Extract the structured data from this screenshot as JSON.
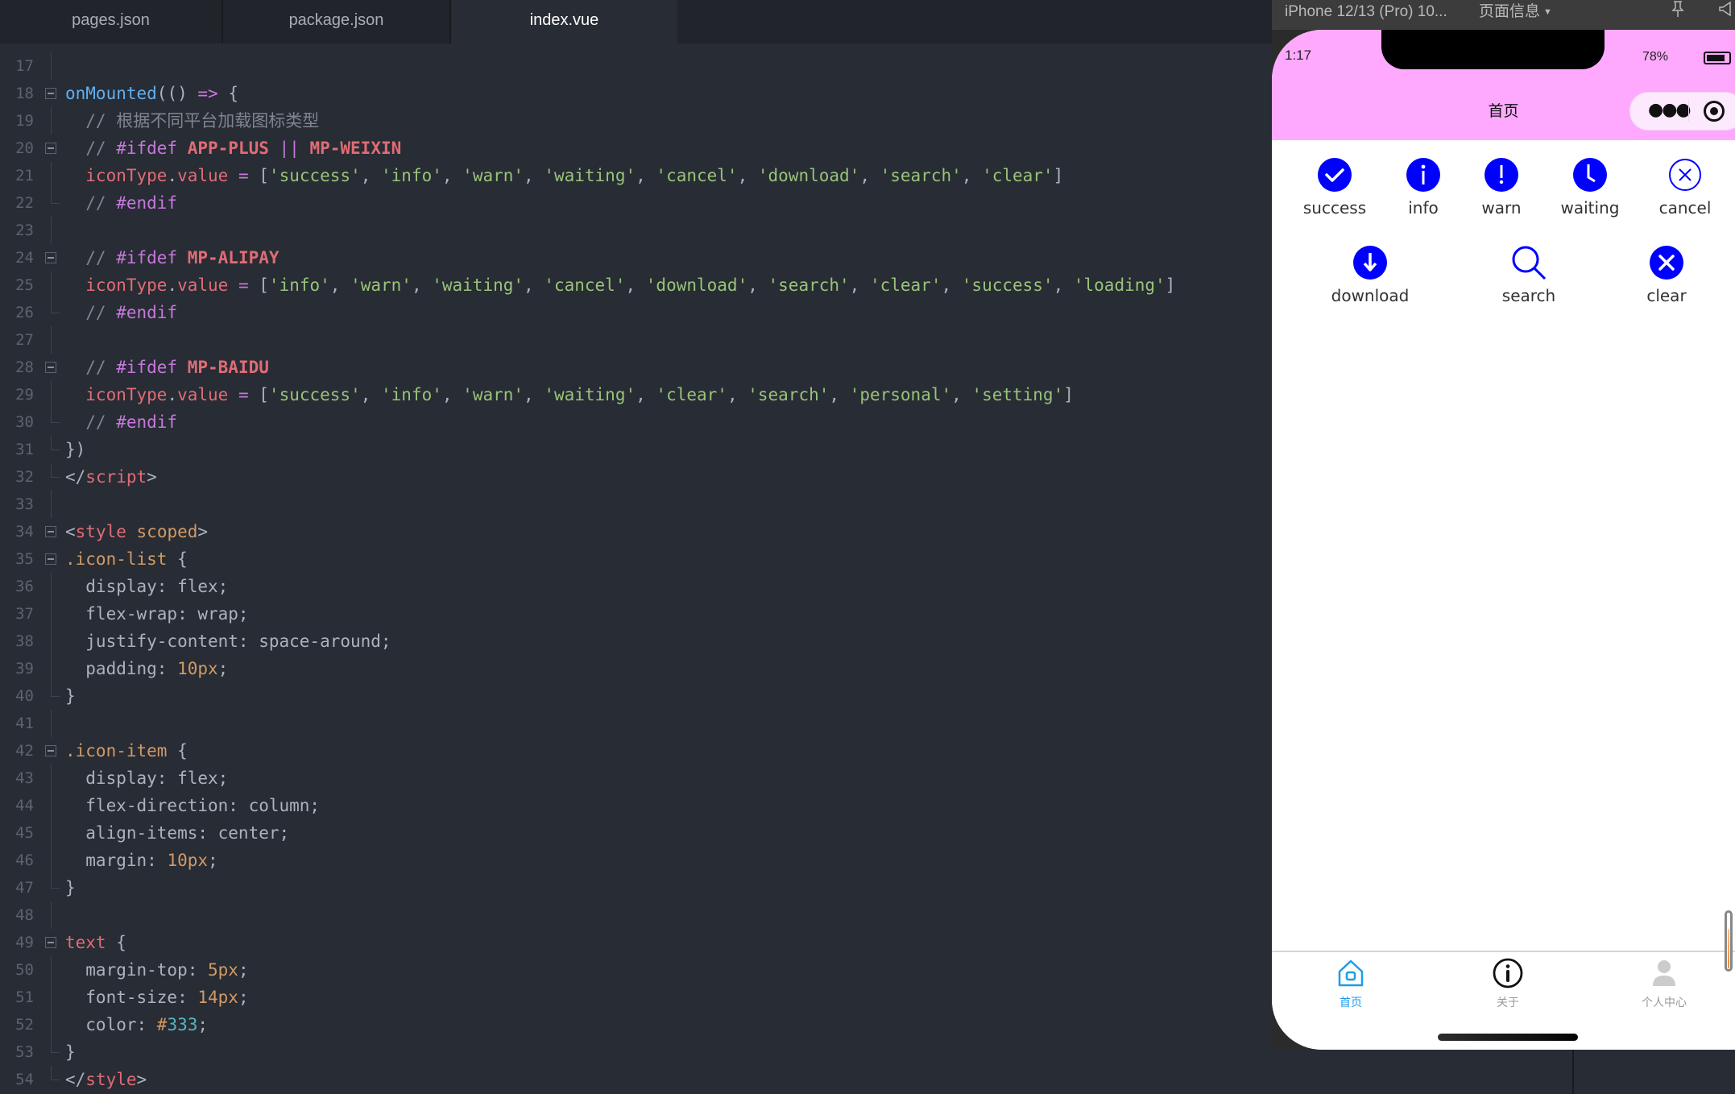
{
  "editor": {
    "tabs": [
      {
        "label": "pages.json",
        "active": false
      },
      {
        "label": "package.json",
        "active": false
      },
      {
        "label": "index.vue",
        "active": true
      }
    ],
    "lines": [
      {
        "num": "17",
        "tokens": []
      },
      {
        "num": "18",
        "tokens": [
          [
            "fn",
            "onMounted"
          ],
          [
            "plain",
            "(() "
          ],
          [
            "op",
            "=>"
          ],
          [
            "plain",
            " {"
          ]
        ]
      },
      {
        "num": "19",
        "tokens": [
          [
            "com",
            "  // 根据不同平台加载图标类型"
          ]
        ]
      },
      {
        "num": "20",
        "tokens": [
          [
            "com",
            "  // "
          ],
          [
            "dir",
            "#ifdef "
          ],
          [
            "mac",
            "APP-PLUS "
          ],
          [
            "op",
            "|| "
          ],
          [
            "mac",
            "MP-WEIXIN"
          ]
        ]
      },
      {
        "num": "21",
        "tokens": [
          [
            "var",
            "  iconType"
          ],
          [
            "plain",
            "."
          ],
          [
            "var",
            "value"
          ],
          [
            "plain",
            " "
          ],
          [
            "op",
            "="
          ],
          [
            "plain",
            " ["
          ],
          [
            "str",
            "'success'"
          ],
          [
            "plain",
            ", "
          ],
          [
            "str",
            "'info'"
          ],
          [
            "plain",
            ", "
          ],
          [
            "str",
            "'warn'"
          ],
          [
            "plain",
            ", "
          ],
          [
            "str",
            "'waiting'"
          ],
          [
            "plain",
            ", "
          ],
          [
            "str",
            "'cancel'"
          ],
          [
            "plain",
            ", "
          ],
          [
            "str",
            "'download'"
          ],
          [
            "plain",
            ", "
          ],
          [
            "str",
            "'search'"
          ],
          [
            "plain",
            ", "
          ],
          [
            "str",
            "'clear'"
          ],
          [
            "plain",
            "]"
          ]
        ]
      },
      {
        "num": "22",
        "tokens": [
          [
            "com",
            "  // "
          ],
          [
            "dir",
            "#endif"
          ]
        ]
      },
      {
        "num": "23",
        "tokens": []
      },
      {
        "num": "24",
        "tokens": [
          [
            "com",
            "  // "
          ],
          [
            "dir",
            "#ifdef "
          ],
          [
            "mac",
            "MP-ALIPAY"
          ]
        ]
      },
      {
        "num": "25",
        "tokens": [
          [
            "var",
            "  iconType"
          ],
          [
            "plain",
            "."
          ],
          [
            "var",
            "value"
          ],
          [
            "plain",
            " "
          ],
          [
            "op",
            "="
          ],
          [
            "plain",
            " ["
          ],
          [
            "str",
            "'info'"
          ],
          [
            "plain",
            ", "
          ],
          [
            "str",
            "'warn'"
          ],
          [
            "plain",
            ", "
          ],
          [
            "str",
            "'waiting'"
          ],
          [
            "plain",
            ", "
          ],
          [
            "str",
            "'cancel'"
          ],
          [
            "plain",
            ", "
          ],
          [
            "str",
            "'download'"
          ],
          [
            "plain",
            ", "
          ],
          [
            "str",
            "'search'"
          ],
          [
            "plain",
            ", "
          ],
          [
            "str",
            "'clear'"
          ],
          [
            "plain",
            ", "
          ],
          [
            "str",
            "'success'"
          ],
          [
            "plain",
            ", "
          ],
          [
            "str",
            "'loading'"
          ],
          [
            "plain",
            "]"
          ]
        ]
      },
      {
        "num": "26",
        "tokens": [
          [
            "com",
            "  // "
          ],
          [
            "dir",
            "#endif"
          ]
        ]
      },
      {
        "num": "27",
        "tokens": []
      },
      {
        "num": "28",
        "tokens": [
          [
            "com",
            "  // "
          ],
          [
            "dir",
            "#ifdef "
          ],
          [
            "mac",
            "MP-BAIDU"
          ]
        ]
      },
      {
        "num": "29",
        "tokens": [
          [
            "var",
            "  iconType"
          ],
          [
            "plain",
            "."
          ],
          [
            "var",
            "value"
          ],
          [
            "plain",
            " "
          ],
          [
            "op",
            "="
          ],
          [
            "plain",
            " ["
          ],
          [
            "str",
            "'success'"
          ],
          [
            "plain",
            ", "
          ],
          [
            "str",
            "'info'"
          ],
          [
            "plain",
            ", "
          ],
          [
            "str",
            "'warn'"
          ],
          [
            "plain",
            ", "
          ],
          [
            "str",
            "'waiting'"
          ],
          [
            "plain",
            ", "
          ],
          [
            "str",
            "'clear'"
          ],
          [
            "plain",
            ", "
          ],
          [
            "str",
            "'search'"
          ],
          [
            "plain",
            ", "
          ],
          [
            "str",
            "'personal'"
          ],
          [
            "plain",
            ", "
          ],
          [
            "str",
            "'setting'"
          ],
          [
            "plain",
            "]"
          ]
        ]
      },
      {
        "num": "30",
        "tokens": [
          [
            "com",
            "  // "
          ],
          [
            "dir",
            "#endif"
          ]
        ]
      },
      {
        "num": "31",
        "tokens": [
          [
            "plain",
            "})"
          ]
        ]
      },
      {
        "num": "32",
        "tokens": [
          [
            "plain",
            "</"
          ],
          [
            "tag",
            "script"
          ],
          [
            "plain",
            ">"
          ]
        ]
      },
      {
        "num": "33",
        "tokens": []
      },
      {
        "num": "34",
        "tokens": [
          [
            "plain",
            "<"
          ],
          [
            "tag",
            "style"
          ],
          [
            "plain",
            " "
          ],
          [
            "attr",
            "scoped"
          ],
          [
            "plain",
            ">"
          ]
        ]
      },
      {
        "num": "35",
        "tokens": [
          [
            "sel",
            ".icon-list"
          ],
          [
            "plain",
            " {"
          ]
        ]
      },
      {
        "num": "36",
        "tokens": [
          [
            "plain",
            "  display: flex;"
          ]
        ]
      },
      {
        "num": "37",
        "tokens": [
          [
            "plain",
            "  flex-wrap: wrap;"
          ]
        ]
      },
      {
        "num": "38",
        "tokens": [
          [
            "plain",
            "  justify-content: space-around;"
          ]
        ]
      },
      {
        "num": "39",
        "tokens": [
          [
            "plain",
            "  padding: "
          ],
          [
            "num",
            "10px"
          ],
          [
            "plain",
            ";"
          ]
        ]
      },
      {
        "num": "40",
        "tokens": [
          [
            "plain",
            "}"
          ]
        ]
      },
      {
        "num": "41",
        "tokens": []
      },
      {
        "num": "42",
        "tokens": [
          [
            "sel",
            ".icon-item"
          ],
          [
            "plain",
            " {"
          ]
        ]
      },
      {
        "num": "43",
        "tokens": [
          [
            "plain",
            "  display: flex;"
          ]
        ]
      },
      {
        "num": "44",
        "tokens": [
          [
            "plain",
            "  flex-direction: column;"
          ]
        ]
      },
      {
        "num": "45",
        "tokens": [
          [
            "plain",
            "  align-items: center;"
          ]
        ]
      },
      {
        "num": "46",
        "tokens": [
          [
            "plain",
            "  margin: "
          ],
          [
            "num",
            "10px"
          ],
          [
            "plain",
            ";"
          ]
        ]
      },
      {
        "num": "47",
        "tokens": [
          [
            "plain",
            "}"
          ]
        ]
      },
      {
        "num": "48",
        "tokens": []
      },
      {
        "num": "49",
        "tokens": [
          [
            "tag",
            "text"
          ],
          [
            "plain",
            " {"
          ]
        ]
      },
      {
        "num": "50",
        "tokens": [
          [
            "plain",
            "  margin-top: "
          ],
          [
            "num",
            "5px"
          ],
          [
            "plain",
            ";"
          ]
        ]
      },
      {
        "num": "51",
        "tokens": [
          [
            "plain",
            "  font-size: "
          ],
          [
            "num",
            "14px"
          ],
          [
            "plain",
            ";"
          ]
        ]
      },
      {
        "num": "52",
        "tokens": [
          [
            "plain",
            "  color: "
          ],
          [
            "num",
            "#"
          ],
          [
            "hex",
            "333"
          ],
          [
            "plain",
            ";"
          ]
        ]
      },
      {
        "num": "53",
        "tokens": [
          [
            "plain",
            "}"
          ]
        ]
      },
      {
        "num": "54",
        "tokens": [
          [
            "plain",
            "</"
          ],
          [
            "tag",
            "style"
          ],
          [
            "plain",
            ">"
          ]
        ]
      }
    ],
    "fold_lines": [
      "18",
      "20",
      "24",
      "28",
      "34",
      "35",
      "42",
      "49"
    ],
    "fold_end_lines": [
      "22",
      "26",
      "30",
      "31",
      "32",
      "40",
      "47",
      "53",
      "54"
    ]
  },
  "simulator": {
    "device_label": "iPhone 12/13 (Pro) 10...",
    "page_info_label": "页面信息",
    "pin_icon": "pin-icon",
    "sound_icon": "speaker-icon",
    "status_time": "1:17",
    "battery_percent": "78%",
    "battery_level": 0.78,
    "nav_title": "首页",
    "nav_bg_color": "#fea9fe",
    "icon_color": "#0000ff",
    "icons": [
      {
        "type": "success",
        "label": "success"
      },
      {
        "type": "info",
        "label": "info"
      },
      {
        "type": "warn",
        "label": "warn"
      },
      {
        "type": "waiting",
        "label": "waiting"
      },
      {
        "type": "cancel",
        "label": "cancel"
      },
      {
        "type": "download",
        "label": "download"
      },
      {
        "type": "search",
        "label": "search"
      },
      {
        "type": "clear",
        "label": "clear"
      }
    ],
    "tabbar": [
      {
        "label": "首页",
        "icon": "home-icon",
        "active": true
      },
      {
        "label": "关于",
        "icon": "info-circle-icon",
        "active": false
      },
      {
        "label": "个人中心",
        "icon": "user-icon",
        "active": false
      }
    ],
    "tabbar_active_color": "#1e9be8"
  }
}
